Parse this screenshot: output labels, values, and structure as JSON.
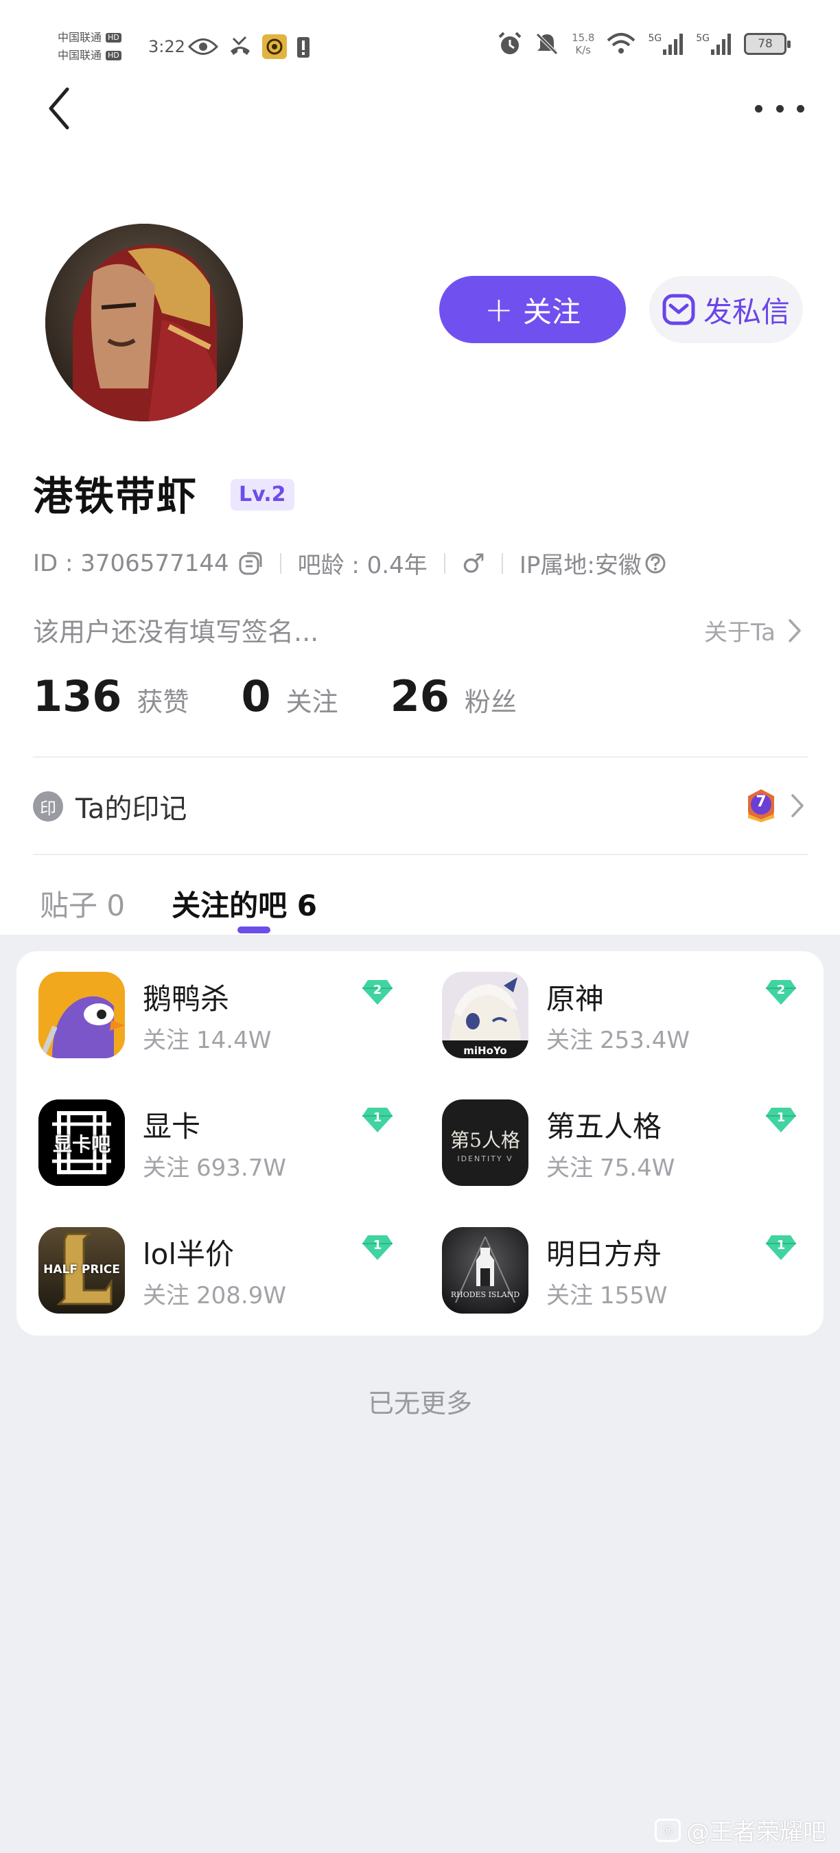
{
  "status_bar": {
    "carrier_1": "中国联通",
    "carrier_2": "中国联通",
    "hd_badge": "HD",
    "time": "3:22",
    "net_speed_value": "15.8",
    "net_speed_unit": "K/s",
    "signal_1": "5G",
    "signal_2": "5G",
    "battery_level": "78"
  },
  "profile": {
    "username": "港铁带虾",
    "level": "Lv.2",
    "follow_button": "关注",
    "message_button": "发私信",
    "id_label": "ID : 3706577144",
    "age_label": "吧龄 : 0.4年",
    "gender_symbol": "♂",
    "ip_label": "IP属地:安徽",
    "bio": "该用户还没有填写签名...",
    "about_link": "关于Ta"
  },
  "stats": [
    {
      "value": "136",
      "label": "获赞"
    },
    {
      "value": "0",
      "label": "关注"
    },
    {
      "value": "26",
      "label": "粉丝"
    }
  ],
  "marks": {
    "badge_char": "印",
    "label": "Ta的印记",
    "count_badge": "7"
  },
  "tabs": [
    {
      "label": "贴子 0",
      "active": false
    },
    {
      "label": "关注的吧 6",
      "active": true
    }
  ],
  "bars": [
    {
      "name": "鹅鸭杀",
      "follow_label": "关注",
      "follow_count": "14.4W",
      "level": "2",
      "icon": "goose-goose-duck-icon",
      "accent": "#f2a81d"
    },
    {
      "name": "原神",
      "follow_label": "关注",
      "follow_count": "253.4W",
      "level": "2",
      "icon": "genshin-paimon-icon",
      "accent": "#e9e4ec",
      "logo_text": "miHoYo"
    },
    {
      "name": "显卡",
      "follow_label": "关注",
      "follow_count": "693.7W",
      "level": "1",
      "icon": "gpu-bar-icon",
      "accent": "#000000",
      "logo_text": "显卡吧"
    },
    {
      "name": "第五人格",
      "follow_label": "关注",
      "follow_count": "75.4W",
      "level": "1",
      "icon": "identity-v-icon",
      "accent": "#1c1c1c",
      "logo_text": "第5人格",
      "logo_sub": "IDENTITY V"
    },
    {
      "name": "lol半价",
      "follow_label": "关注",
      "follow_count": "208.9W",
      "level": "1",
      "icon": "lol-half-price-icon",
      "accent": "#3a3222",
      "logo_text": "HALF PRICE"
    },
    {
      "name": "明日方舟",
      "follow_label": "关注",
      "follow_count": "155W",
      "level": "1",
      "icon": "arknights-icon",
      "accent": "#2a2a2c",
      "logo_text": "RHODES ISLAND"
    }
  ],
  "footer": {
    "no_more": "已无更多",
    "watermark": "@王者荣耀吧"
  },
  "colors": {
    "accent": "#7150f0",
    "gem": "#3fd4a0",
    "page_bg": "#eeeff2"
  }
}
